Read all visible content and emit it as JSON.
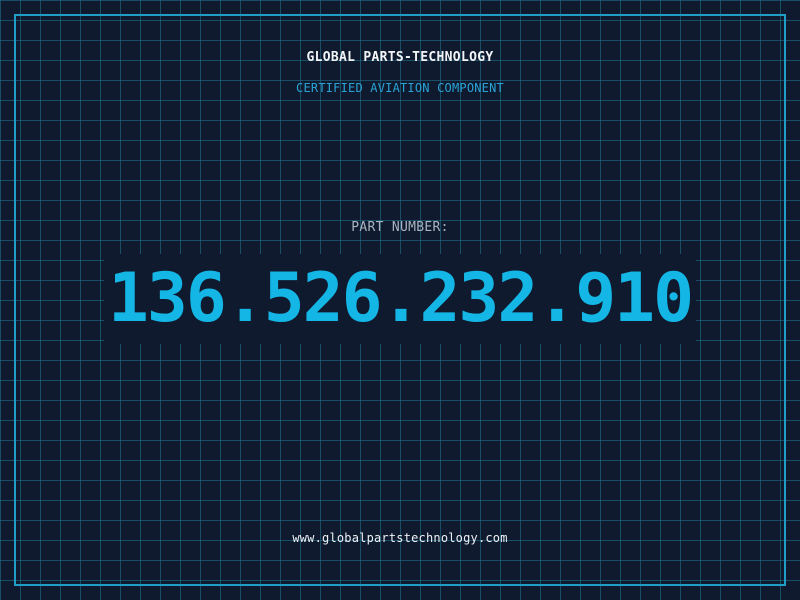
{
  "header": {
    "brand": "GLOBAL PARTS-TECHNOLOGY",
    "tagline": "CERTIFIED AVIATION COMPONENT"
  },
  "main": {
    "part_label": "PART NUMBER:",
    "part_number": "136.526.232.910"
  },
  "footer": {
    "url": "www.globalpartstechnology.com"
  },
  "colors": {
    "background": "#101a2e",
    "grid": "#23789a",
    "accent": "#14b6e6",
    "frame": "#1f9fc8",
    "text": "#f2f5f8"
  }
}
